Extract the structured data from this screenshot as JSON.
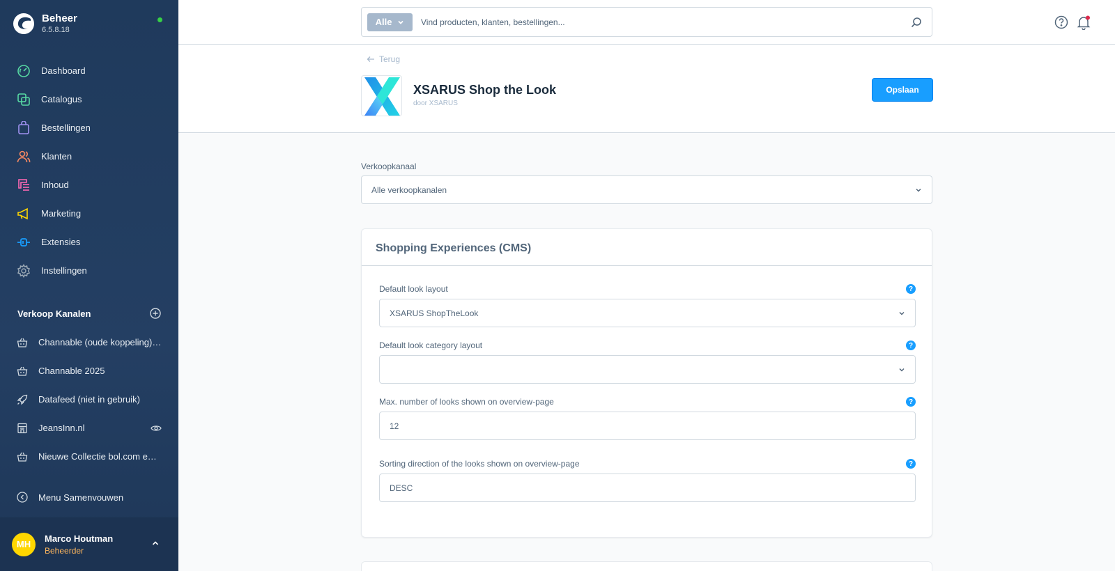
{
  "brand": {
    "title": "Beheer",
    "version": "6.5.8.18"
  },
  "nav": [
    {
      "label": "Dashboard",
      "icon": "dashboard-icon",
      "color": "#57d9a3"
    },
    {
      "label": "Catalogus",
      "icon": "catalogue-icon",
      "color": "#57d9a3"
    },
    {
      "label": "Bestellingen",
      "icon": "orders-icon",
      "color": "#a092f0"
    },
    {
      "label": "Klanten",
      "icon": "customers-icon",
      "color": "#f88962"
    },
    {
      "label": "Inhoud",
      "icon": "content-icon",
      "color": "#ff68b4"
    },
    {
      "label": "Marketing",
      "icon": "marketing-icon",
      "color": "#ffd700"
    },
    {
      "label": "Extensies",
      "icon": "extensions-icon",
      "color": "#189eff"
    },
    {
      "label": "Instellingen",
      "icon": "settings-icon",
      "color": "#9aa8b5"
    }
  ],
  "sales_channels": {
    "title": "Verkoop Kanalen",
    "items": [
      {
        "label": "Channable (oude koppeling) (niet in gebruik)",
        "icon": "basket-icon"
      },
      {
        "label": "Channable 2025",
        "icon": "basket-icon"
      },
      {
        "label": "Datafeed (niet in gebruik)",
        "icon": "rocket-icon"
      },
      {
        "label": "JeansInn.nl",
        "icon": "storefront-icon"
      },
      {
        "label": "Nieuwe Collectie bol.com en Channable",
        "icon": "basket-icon"
      }
    ]
  },
  "collapse_label": "Menu Samenvouwen",
  "user": {
    "initials": "MH",
    "name": "Marco Houtman",
    "role": "Beheerder"
  },
  "search": {
    "type_label": "Alle",
    "placeholder": "Vind producten, klanten, bestellingen..."
  },
  "header": {
    "back_label": "Terug",
    "title": "XSARUS Shop the Look",
    "author": "door XSARUS",
    "save_label": "Opslaan"
  },
  "sales_channel_field": {
    "label": "Verkoopkanaal",
    "value": "Alle verkoopkanalen"
  },
  "card": {
    "title": "Shopping Experiences (CMS)",
    "fields": [
      {
        "label": "Default look layout",
        "value": "XSARUS ShopTheLook",
        "type": "select"
      },
      {
        "label": "Default look category layout",
        "value": "",
        "type": "select"
      },
      {
        "label": "Max. number of looks shown on overview-page",
        "value": "12",
        "type": "input"
      },
      {
        "label": "Sorting direction of the looks shown on overview-page",
        "value": "DESC",
        "type": "input"
      }
    ]
  },
  "colors": {
    "accent": "#189eff",
    "sidebar": "#1f3a5c",
    "online": "#37d046",
    "avatar": "#ffd700",
    "role": "#ffb75d"
  }
}
